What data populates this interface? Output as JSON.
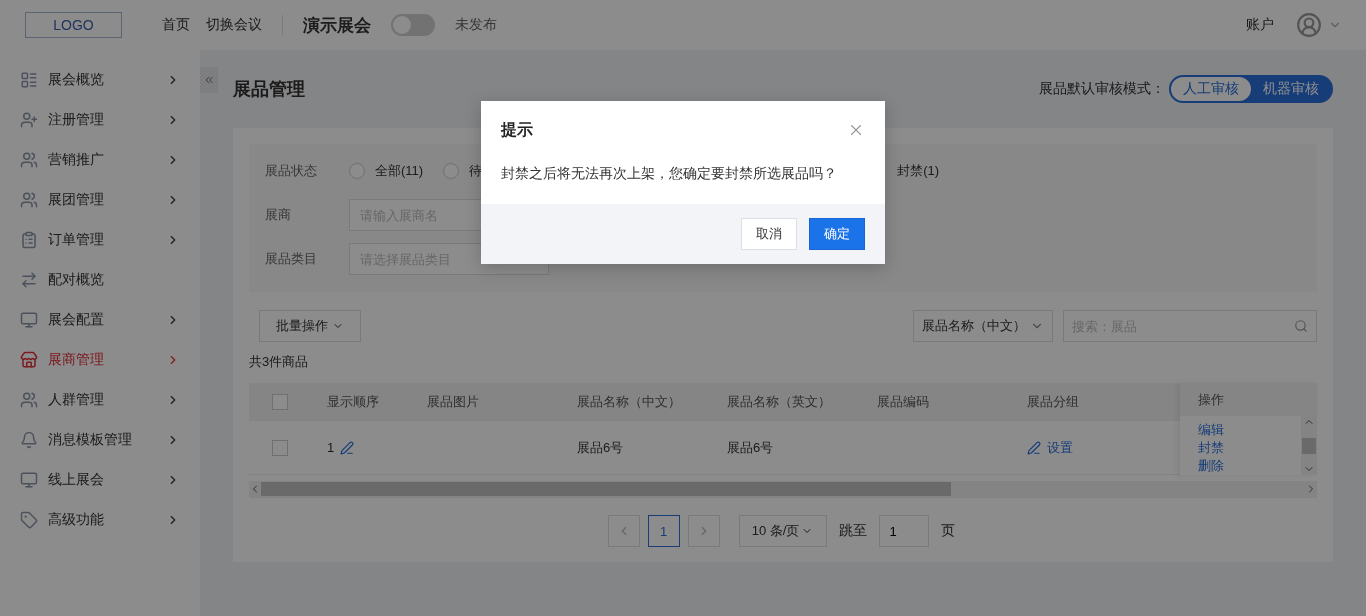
{
  "header": {
    "logo": "LOGO",
    "nav": [
      "首页",
      "切换会议"
    ],
    "event_title": "演示展会",
    "publish_switch": {
      "on": false
    },
    "publish_status": "未发布",
    "account": "账户"
  },
  "sidebar": {
    "items": [
      {
        "label": "展会概览",
        "expandable": true,
        "selected": false
      },
      {
        "label": "注册管理",
        "expandable": true,
        "selected": false
      },
      {
        "label": "营销推广",
        "expandable": true,
        "selected": false
      },
      {
        "label": "展团管理",
        "expandable": true,
        "selected": false
      },
      {
        "label": "订单管理",
        "expandable": true,
        "selected": false
      },
      {
        "label": "配对概览",
        "expandable": false,
        "selected": false
      },
      {
        "label": "展会配置",
        "expandable": true,
        "selected": false
      },
      {
        "label": "展商管理",
        "expandable": true,
        "selected": true
      },
      {
        "label": "人群管理",
        "expandable": true,
        "selected": false
      },
      {
        "label": "消息模板管理",
        "expandable": true,
        "selected": false
      },
      {
        "label": "线上展会",
        "expandable": true,
        "selected": false
      },
      {
        "label": "高级功能",
        "expandable": true,
        "selected": false
      }
    ]
  },
  "page": {
    "title": "展品管理",
    "review_mode": {
      "label": "展品默认审核模式：",
      "options": [
        {
          "label": "人工审核",
          "selected": false
        },
        {
          "label": "机器审核",
          "selected": true
        }
      ]
    }
  },
  "filters": {
    "status": {
      "label": "展品状态",
      "options": [
        {
          "label": "全部(11)",
          "checked": false
        },
        {
          "label": "待",
          "checked": false
        }
      ],
      "trailing_label": "封禁(1)"
    },
    "exhibitor": {
      "label": "展商",
      "placeholder": "请输入展商名"
    },
    "category": {
      "label": "展品类目",
      "placeholder": "请选择展品类目"
    }
  },
  "toolbar": {
    "batch": "批量操作",
    "field_select": "展品名称（中文）",
    "search_placeholder": "搜索：展品"
  },
  "count": "共3件商品",
  "table": {
    "header_checked": false,
    "columns": [
      "显示顺序",
      "展品图片",
      "展品名称（中文）",
      "展品名称（英文）",
      "展品编码",
      "展品分组"
    ],
    "action_column": "操作",
    "rows": [
      {
        "checked": false,
        "order": "1",
        "name_cn": "展品6号",
        "name_en": "展品6号",
        "group": "设置",
        "actions": [
          "编辑",
          "封禁",
          "删除"
        ]
      }
    ]
  },
  "pagination": {
    "page": "1",
    "page_size": "10 条/页",
    "jump_label": "跳至",
    "jump_value": "1",
    "page_unit": "页"
  },
  "dialog": {
    "title": "提示",
    "message": "封禁之后将无法再次上架，您确定要封禁所选展品吗？",
    "buttons": [
      {
        "label": "取消",
        "kind": "secondary"
      },
      {
        "label": "确定",
        "kind": "primary"
      }
    ]
  }
}
